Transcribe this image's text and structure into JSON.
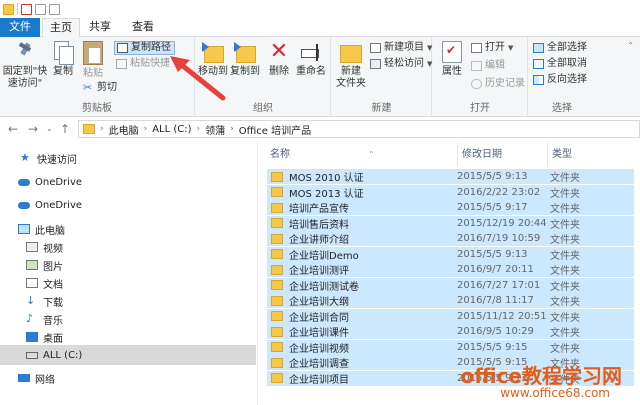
{
  "quick_access_toolbar": {
    "icons": [
      "folder-icon",
      "properties-icon",
      "new-folder-icon",
      "dropdown-icon"
    ]
  },
  "tabs": {
    "file": "文件",
    "home": "主页",
    "share": "共享",
    "view": "查看"
  },
  "ribbon": {
    "clipboard": {
      "label": "剪贴板",
      "pin": "固定到\"快\n速访问\"",
      "copy": "复制",
      "paste": "粘贴",
      "copy_path": "复制路径",
      "paste_shortcut": "粘贴快捷",
      "cut": "剪切"
    },
    "organize": {
      "label": "组织",
      "move_to": "移动到",
      "copy_to": "复制到",
      "delete": "删除",
      "rename": "重命名"
    },
    "new": {
      "label": "新建",
      "new_folder": "新建\n文件夹",
      "new_item": "新建项目",
      "easy_access": "轻松访问"
    },
    "open": {
      "label": "打开",
      "properties": "属性",
      "open": "打开",
      "edit": "编辑",
      "history": "历史记录"
    },
    "select": {
      "label": "选择",
      "select_all": "全部选择",
      "select_none": "全部取消",
      "invert": "反向选择"
    }
  },
  "address_bar": {
    "path": [
      "此电脑",
      "ALL (C:)",
      "领蒲",
      "Office 培训产品"
    ]
  },
  "sidebar": {
    "items": [
      {
        "label": "快速访问",
        "icon": "star-icon"
      },
      {
        "label": "OneDrive",
        "icon": "cloud-icon"
      },
      {
        "label": "OneDrive",
        "icon": "cloud-icon"
      },
      {
        "label": "此电脑",
        "icon": "computer-icon"
      },
      {
        "label": "视频",
        "icon": "video-icon"
      },
      {
        "label": "图片",
        "icon": "picture-icon"
      },
      {
        "label": "文档",
        "icon": "document-icon"
      },
      {
        "label": "下载",
        "icon": "download-icon"
      },
      {
        "label": "音乐",
        "icon": "music-icon"
      },
      {
        "label": "桌面",
        "icon": "desktop-icon"
      },
      {
        "label": "ALL (C:)",
        "icon": "drive-icon"
      },
      {
        "label": "网络",
        "icon": "network-icon"
      }
    ]
  },
  "file_list": {
    "columns": {
      "name": "名称",
      "date": "修改日期",
      "type": "类型"
    },
    "rows": [
      {
        "name": "MOS 2010 认证",
        "date": "2015/5/5 9:13",
        "type": "文件夹"
      },
      {
        "name": "MOS 2013 认证",
        "date": "2016/2/22 23:02",
        "type": "文件夹"
      },
      {
        "name": "培训产品宣传",
        "date": "2015/5/5 9:17",
        "type": "文件夹"
      },
      {
        "name": "培训售后资料",
        "date": "2015/12/19 20:44",
        "type": "文件夹"
      },
      {
        "name": "企业讲师介绍",
        "date": "2016/7/19 10:59",
        "type": "文件夹"
      },
      {
        "name": "企业培训Demo",
        "date": "2015/5/5 9:13",
        "type": "文件夹"
      },
      {
        "name": "企业培训测评",
        "date": "2016/9/7 20:11",
        "type": "文件夹"
      },
      {
        "name": "企业培训测试卷",
        "date": "2016/7/27 17:01",
        "type": "文件夹"
      },
      {
        "name": "企业培训大纲",
        "date": "2016/7/8 11:17",
        "type": "文件夹"
      },
      {
        "name": "企业培训合同",
        "date": "2015/11/12 20:51",
        "type": "文件夹"
      },
      {
        "name": "企业培训课件",
        "date": "2016/9/5 10:29",
        "type": "文件夹"
      },
      {
        "name": "企业培训视频",
        "date": "2015/5/5 9:15",
        "type": "文件夹"
      },
      {
        "name": "企业培训调查",
        "date": "2015/5/5 9:15",
        "type": "文件夹"
      },
      {
        "name": "企业培训项目",
        "date": "2015/5/5 9:17",
        "type": "文件夹"
      }
    ]
  },
  "watermark": {
    "line1": "office教程学习网",
    "line2": "www.office68.com"
  },
  "colors": {
    "accent": "#1979ca",
    "selection": "#cce8ff",
    "folder": "#f6c84a",
    "arrow": "#e8413b"
  }
}
